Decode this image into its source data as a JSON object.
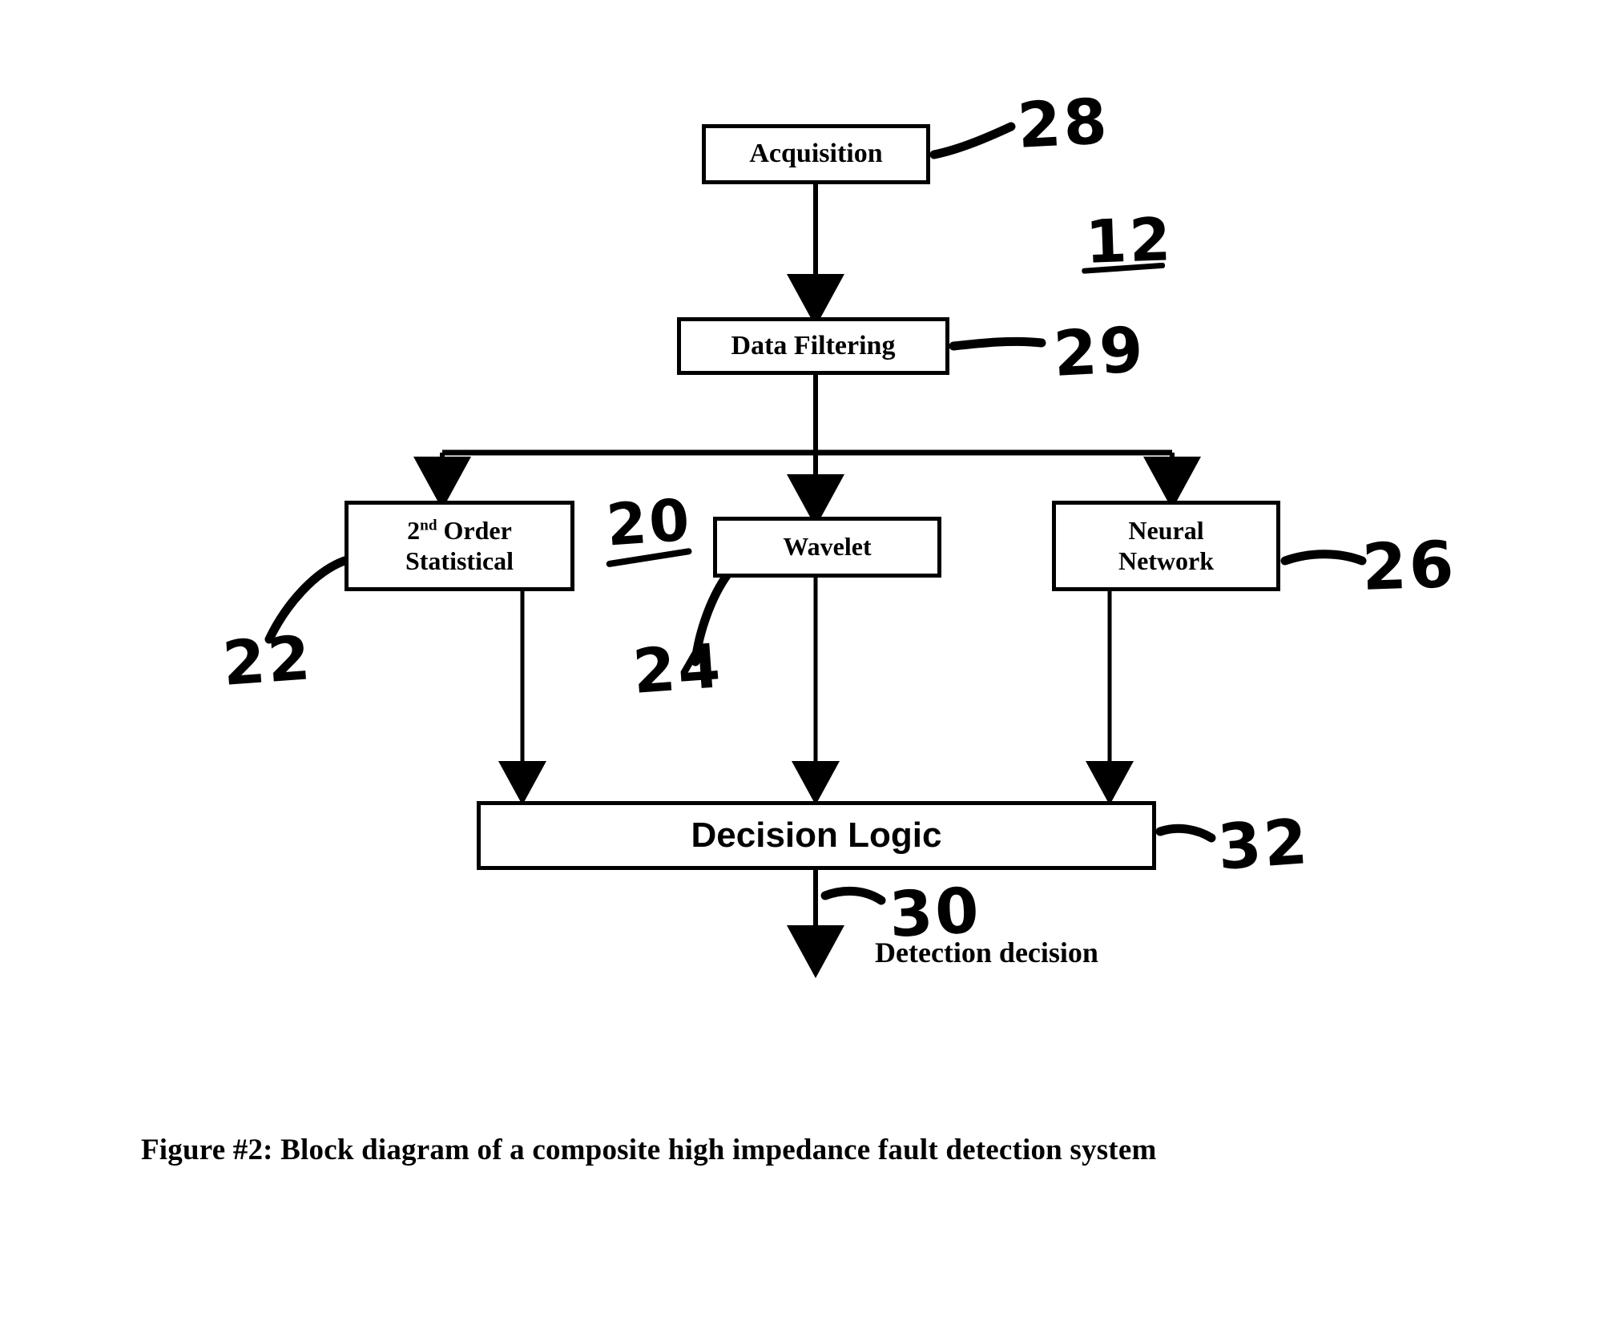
{
  "figure": {
    "caption": "Figure #2: Block diagram of a composite high impedance fault detection system",
    "output_label": "Detection decision"
  },
  "nodes": {
    "acquisition": {
      "label": "Acquisition"
    },
    "data_filtering": {
      "label": "Data Filtering"
    },
    "second_order": {
      "label_main": "2",
      "label_sup": "nd",
      "label_rest": " Order",
      "label_line2": "Statistical"
    },
    "wavelet": {
      "label": "Wavelet"
    },
    "neural_network": {
      "label_line1": "Neural",
      "label_line2": "Network"
    },
    "decision_logic": {
      "label": "Decision Logic"
    }
  },
  "reference_numerals": {
    "system": "12",
    "analysis_group": "20",
    "second_order": "22",
    "wavelet": "24",
    "neural_network": "26",
    "acquisition": "28",
    "data_filtering": "29",
    "output": "30",
    "decision_logic": "32"
  },
  "colors": {
    "ink": "#000000",
    "paper": "#ffffff"
  }
}
